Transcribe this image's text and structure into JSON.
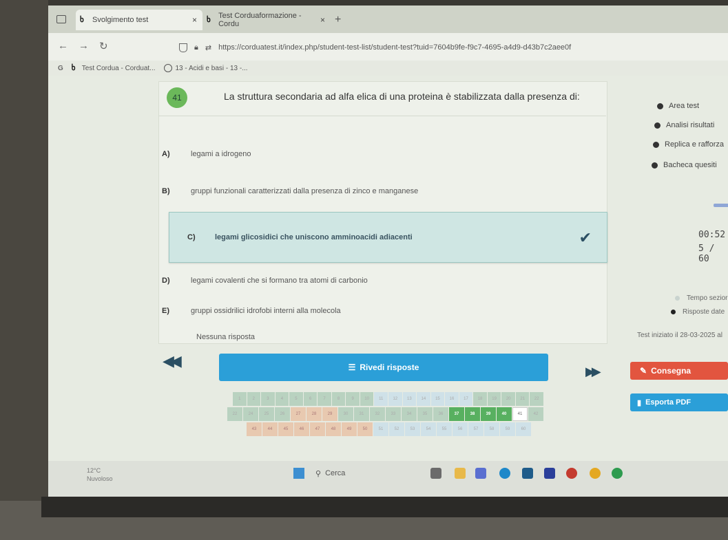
{
  "browser": {
    "tabs": [
      {
        "title": "Svolgimento test",
        "close": "×"
      },
      {
        "title": "Test Corduaformazione - Cordu",
        "close": "×"
      }
    ],
    "new_tab": "+",
    "url": "https://corduatest.it/index.php/student-test-list/student-test?tuid=7604b9fe-f9c7-4695-a4d9-d43b7c2aee0f",
    "bookmarks": [
      {
        "label": "Test Cordua - Corduat..."
      },
      {
        "label": "13 - Acidi e basi - 13 -..."
      }
    ]
  },
  "question": {
    "number": "41",
    "text": "La struttura secondaria ad alfa elica di una proteina è stabilizzata dalla presenza di:",
    "answers": [
      {
        "letter": "A)",
        "text": "legami a idrogeno"
      },
      {
        "letter": "B)",
        "text": "gruppi funzionali caratterizzati dalla presenza di zinco e manganese"
      },
      {
        "letter": "C)",
        "text": "legami glicosidici che uniscono amminoacidi adiacenti"
      },
      {
        "letter": "D)",
        "text": "legami covalenti che si formano tra atomi di carbonio"
      },
      {
        "letter": "E)",
        "text": "gruppi ossidrilici idrofobi interni alla molecola"
      }
    ],
    "selected_index": 2,
    "no_answer": "Nessuna risposta"
  },
  "sidebar": {
    "links": [
      "Area test",
      "Analisi risultati",
      "Replica e rafforza",
      "Bacheca quesiti"
    ],
    "timer": "00:52",
    "progress": "5 / 60",
    "legend": [
      {
        "label": "Tempo sezior",
        "color": "#c9d3cf"
      },
      {
        "label": "Risposte date",
        "color": "#222222"
      }
    ],
    "started": "Test iniziato il 28-03-2025 al"
  },
  "controls": {
    "prev": "◀◀",
    "next": "▶▶",
    "review_label": "Rivedi risposte",
    "submit_label": "Consegna",
    "pdf_label": "Esporta PDF"
  },
  "grid": {
    "rows": [
      [
        "1",
        "2",
        "3",
        "4",
        "5",
        "6",
        "7",
        "8",
        "9",
        "10",
        "11",
        "12",
        "13",
        "14",
        "15",
        "16",
        "17",
        "18",
        "19",
        "20",
        "21",
        "22"
      ],
      [
        "22",
        "24",
        "25",
        "26",
        "27",
        "28",
        "29",
        "30",
        "31",
        "32",
        "33",
        "34",
        "35",
        "36",
        "37",
        "38",
        "39",
        "40",
        "41",
        "42"
      ],
      [
        "43",
        "44",
        "45",
        "46",
        "47",
        "48",
        "49",
        "50",
        "51",
        "52",
        "53",
        "54",
        "55",
        "56",
        "57",
        "58",
        "59",
        "60"
      ]
    ]
  },
  "taskbar": {
    "temp": "12°C",
    "weather": "Nuvoloso",
    "search": "Cerca"
  },
  "colors": {
    "primary": "#2b9fd8",
    "submit": "#e2553f",
    "selected_bg": "#cfe6e3",
    "badge": "#6bb85a"
  }
}
